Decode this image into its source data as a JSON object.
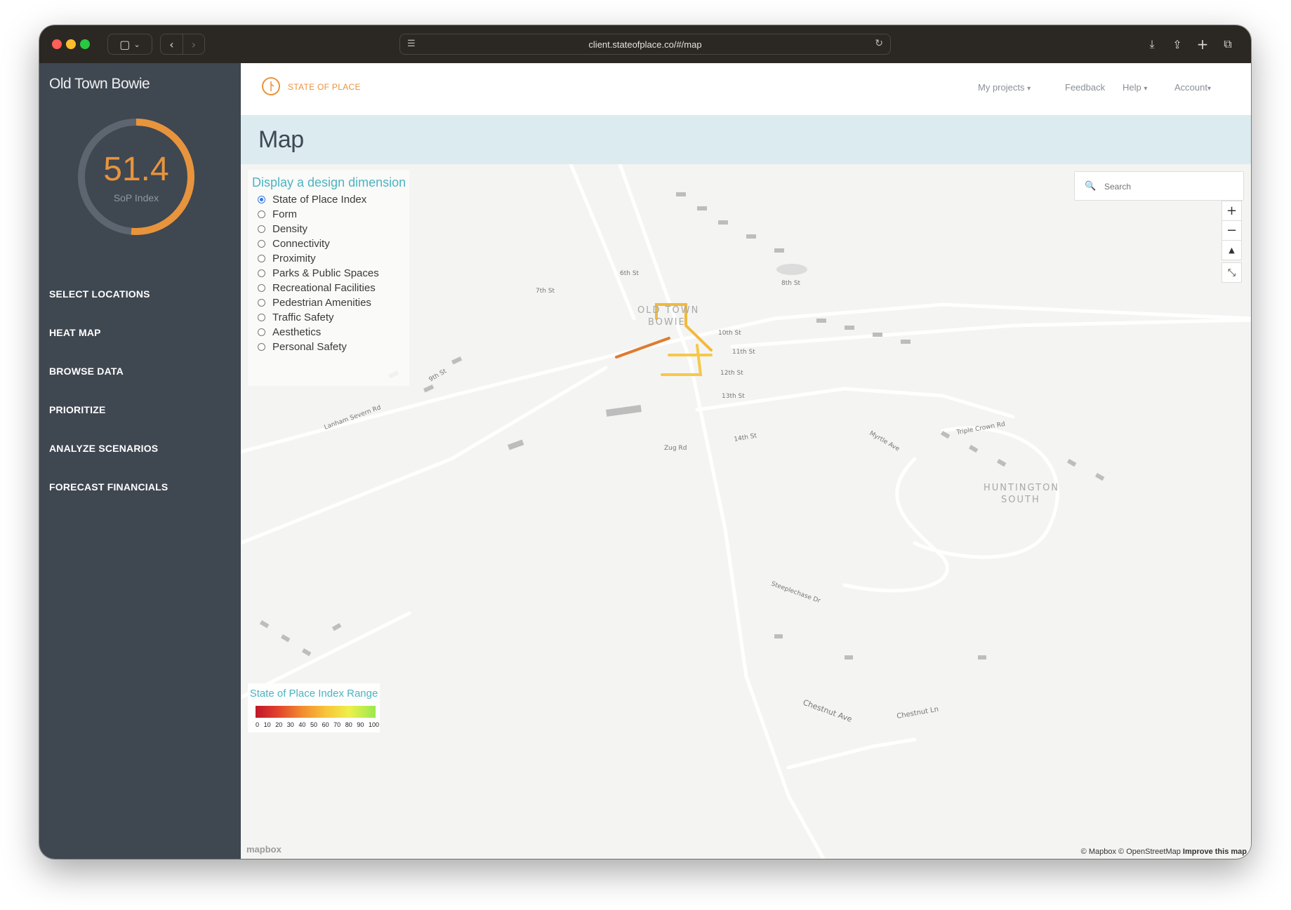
{
  "browser": {
    "url": "client.stateofplace.co/#/map"
  },
  "sidebar": {
    "project_title": "Old Town Bowie",
    "score": {
      "value": "51.4",
      "label": "SoP Index",
      "fraction": 0.514,
      "color": "#e8943c"
    },
    "nav": [
      {
        "label": "SELECT LOCATIONS"
      },
      {
        "label": "HEAT MAP"
      },
      {
        "label": "BROWSE DATA"
      },
      {
        "label": "PRIORITIZE"
      },
      {
        "label": "ANALYZE SCENARIOS"
      },
      {
        "label": "FORECAST FINANCIALS"
      }
    ]
  },
  "topbar": {
    "logo_text": "STATE OF PLACE",
    "menu": [
      {
        "label": "My projects",
        "caret": "▾"
      },
      {
        "label": "Feedback"
      },
      {
        "label": "Help",
        "caret": "▾"
      },
      {
        "label": "Account",
        "caret": "▾"
      }
    ]
  },
  "page": {
    "title": "Map"
  },
  "map": {
    "dimension_panel": {
      "title": "Display a design dimension",
      "selected": "State of Place Index",
      "options": [
        "State of Place Index",
        "Form",
        "Density",
        "Connectivity",
        "Proximity",
        "Parks & Public Spaces",
        "Recreational Facilities",
        "Pedestrian Amenities",
        "Traffic Safety",
        "Aesthetics",
        "Personal Safety"
      ]
    },
    "search": {
      "placeholder": "Search"
    },
    "controls": {
      "zoom_in": "+",
      "zoom_out": "−",
      "compass": "▲",
      "fullscreen": "⤡"
    },
    "place_labels": [
      "OLD TOWN",
      "BOWIE",
      "HUNTINGTON",
      "SOUTH"
    ],
    "street_labels": [
      "Lanham Severn Rd",
      "Chestnut Ave",
      "Chestnut Ln",
      "Steeplechase Dr",
      "Triple Crown Rd",
      "Myrtle Ave",
      "11th St",
      "12th St",
      "13th St",
      "14th St",
      "Zug Rd",
      "9th St",
      "8th St",
      "7th St",
      "6th St",
      "10th St"
    ],
    "legend": {
      "title": "State of Place Index Range",
      "ticks": [
        "0",
        "10",
        "20",
        "30",
        "40",
        "50",
        "60",
        "70",
        "80",
        "90",
        "100"
      ]
    },
    "attribution": {
      "mapbox": "© Mapbox",
      "osm": "© OpenStreetMap",
      "improve": "Improve this map",
      "logo": "mapbox"
    }
  }
}
